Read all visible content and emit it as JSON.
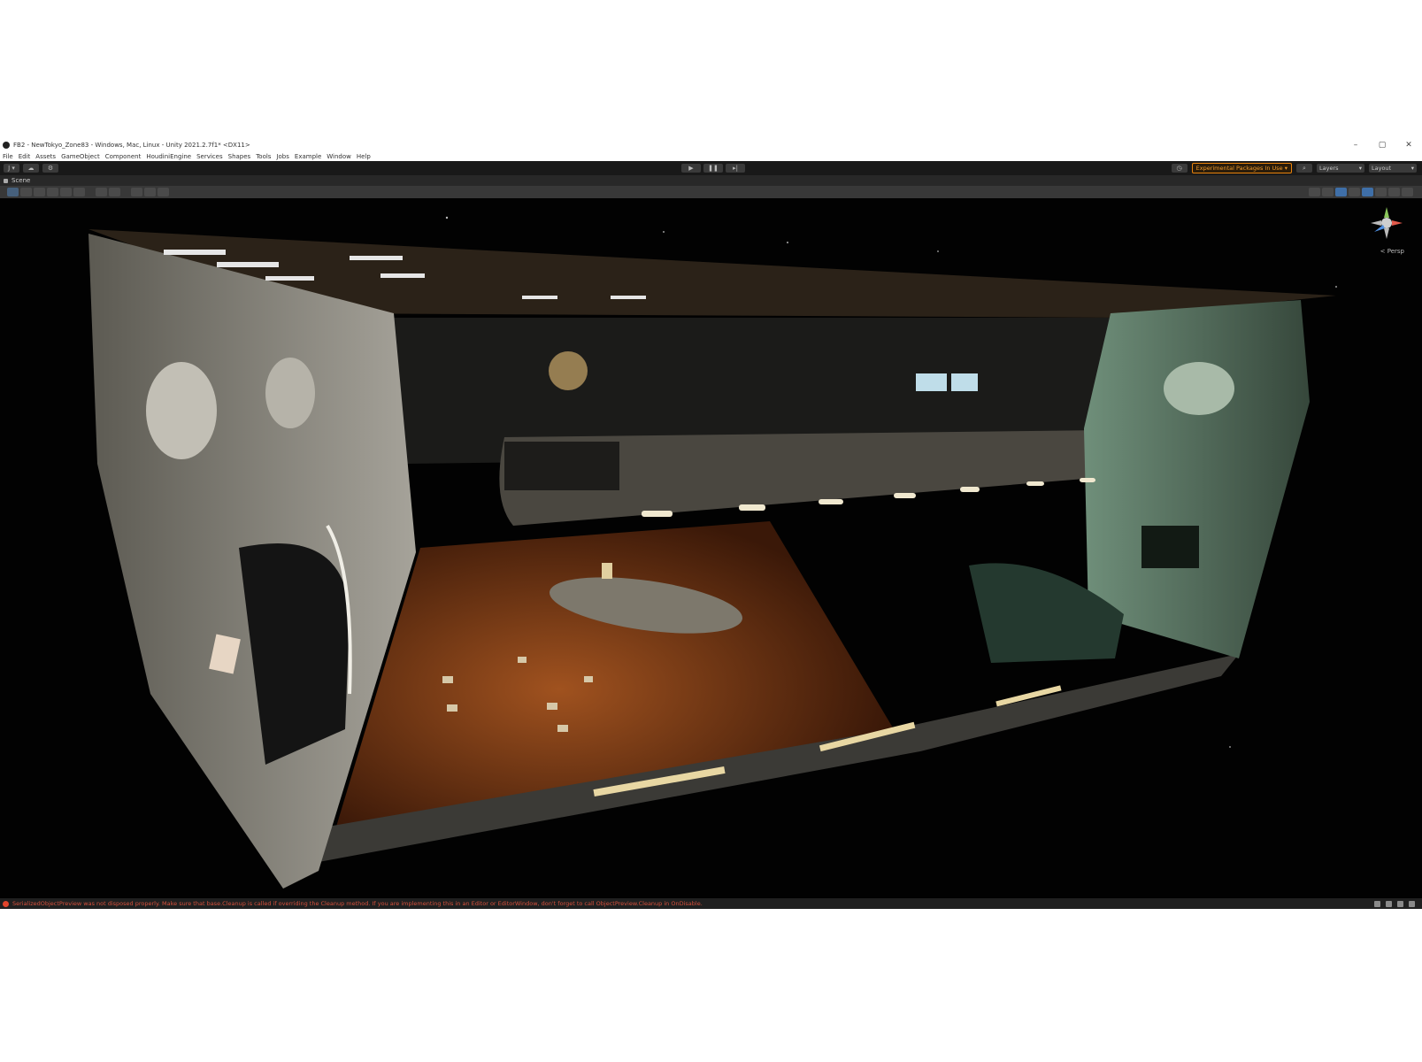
{
  "window": {
    "title": "FB2 - NewTokyo_Zone83 - Windows, Mac, Linux - Unity 2021.2.7f1* <DX11>",
    "controls": [
      "–",
      "▢",
      "✕"
    ]
  },
  "menu": [
    "File",
    "Edit",
    "Assets",
    "GameObject",
    "Component",
    "HoudiniEngine",
    "Services",
    "Shapes",
    "Tools",
    "Jobs",
    "Example",
    "Window",
    "Help"
  ],
  "toolbar": {
    "account_label": "J ▾",
    "experimental_label": "Experimental Packages In Use ▾",
    "layers_label": "Layers",
    "layout_label": "Layout"
  },
  "scene_tab": {
    "label": "Scene"
  },
  "viewport": {
    "persp_label": "< Persp"
  },
  "status": {
    "message": "SerializedObjectPreview was not disposed properly. Make sure that base.Cleanup is called if overriding the Cleanup method. If you are implementing this in an Editor or EditorWindow, don't forget to call ObjectPreview.Cleanup in OnDisable."
  }
}
